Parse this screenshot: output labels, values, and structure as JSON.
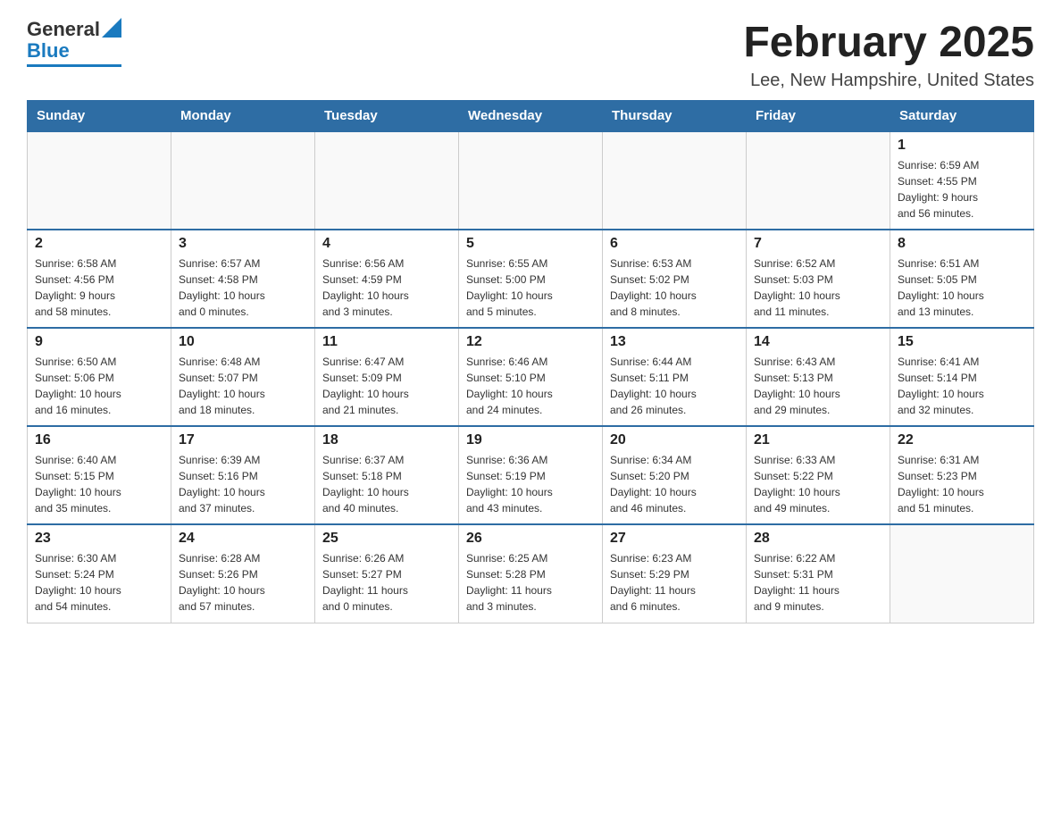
{
  "header": {
    "logo_general": "General",
    "logo_blue": "Blue",
    "title": "February 2025",
    "subtitle": "Lee, New Hampshire, United States"
  },
  "days_of_week": [
    "Sunday",
    "Monday",
    "Tuesday",
    "Wednesday",
    "Thursday",
    "Friday",
    "Saturday"
  ],
  "weeks": [
    [
      {
        "day": "",
        "info": ""
      },
      {
        "day": "",
        "info": ""
      },
      {
        "day": "",
        "info": ""
      },
      {
        "day": "",
        "info": ""
      },
      {
        "day": "",
        "info": ""
      },
      {
        "day": "",
        "info": ""
      },
      {
        "day": "1",
        "info": "Sunrise: 6:59 AM\nSunset: 4:55 PM\nDaylight: 9 hours\nand 56 minutes."
      }
    ],
    [
      {
        "day": "2",
        "info": "Sunrise: 6:58 AM\nSunset: 4:56 PM\nDaylight: 9 hours\nand 58 minutes."
      },
      {
        "day": "3",
        "info": "Sunrise: 6:57 AM\nSunset: 4:58 PM\nDaylight: 10 hours\nand 0 minutes."
      },
      {
        "day": "4",
        "info": "Sunrise: 6:56 AM\nSunset: 4:59 PM\nDaylight: 10 hours\nand 3 minutes."
      },
      {
        "day": "5",
        "info": "Sunrise: 6:55 AM\nSunset: 5:00 PM\nDaylight: 10 hours\nand 5 minutes."
      },
      {
        "day": "6",
        "info": "Sunrise: 6:53 AM\nSunset: 5:02 PM\nDaylight: 10 hours\nand 8 minutes."
      },
      {
        "day": "7",
        "info": "Sunrise: 6:52 AM\nSunset: 5:03 PM\nDaylight: 10 hours\nand 11 minutes."
      },
      {
        "day": "8",
        "info": "Sunrise: 6:51 AM\nSunset: 5:05 PM\nDaylight: 10 hours\nand 13 minutes."
      }
    ],
    [
      {
        "day": "9",
        "info": "Sunrise: 6:50 AM\nSunset: 5:06 PM\nDaylight: 10 hours\nand 16 minutes."
      },
      {
        "day": "10",
        "info": "Sunrise: 6:48 AM\nSunset: 5:07 PM\nDaylight: 10 hours\nand 18 minutes."
      },
      {
        "day": "11",
        "info": "Sunrise: 6:47 AM\nSunset: 5:09 PM\nDaylight: 10 hours\nand 21 minutes."
      },
      {
        "day": "12",
        "info": "Sunrise: 6:46 AM\nSunset: 5:10 PM\nDaylight: 10 hours\nand 24 minutes."
      },
      {
        "day": "13",
        "info": "Sunrise: 6:44 AM\nSunset: 5:11 PM\nDaylight: 10 hours\nand 26 minutes."
      },
      {
        "day": "14",
        "info": "Sunrise: 6:43 AM\nSunset: 5:13 PM\nDaylight: 10 hours\nand 29 minutes."
      },
      {
        "day": "15",
        "info": "Sunrise: 6:41 AM\nSunset: 5:14 PM\nDaylight: 10 hours\nand 32 minutes."
      }
    ],
    [
      {
        "day": "16",
        "info": "Sunrise: 6:40 AM\nSunset: 5:15 PM\nDaylight: 10 hours\nand 35 minutes."
      },
      {
        "day": "17",
        "info": "Sunrise: 6:39 AM\nSunset: 5:16 PM\nDaylight: 10 hours\nand 37 minutes."
      },
      {
        "day": "18",
        "info": "Sunrise: 6:37 AM\nSunset: 5:18 PM\nDaylight: 10 hours\nand 40 minutes."
      },
      {
        "day": "19",
        "info": "Sunrise: 6:36 AM\nSunset: 5:19 PM\nDaylight: 10 hours\nand 43 minutes."
      },
      {
        "day": "20",
        "info": "Sunrise: 6:34 AM\nSunset: 5:20 PM\nDaylight: 10 hours\nand 46 minutes."
      },
      {
        "day": "21",
        "info": "Sunrise: 6:33 AM\nSunset: 5:22 PM\nDaylight: 10 hours\nand 49 minutes."
      },
      {
        "day": "22",
        "info": "Sunrise: 6:31 AM\nSunset: 5:23 PM\nDaylight: 10 hours\nand 51 minutes."
      }
    ],
    [
      {
        "day": "23",
        "info": "Sunrise: 6:30 AM\nSunset: 5:24 PM\nDaylight: 10 hours\nand 54 minutes."
      },
      {
        "day": "24",
        "info": "Sunrise: 6:28 AM\nSunset: 5:26 PM\nDaylight: 10 hours\nand 57 minutes."
      },
      {
        "day": "25",
        "info": "Sunrise: 6:26 AM\nSunset: 5:27 PM\nDaylight: 11 hours\nand 0 minutes."
      },
      {
        "day": "26",
        "info": "Sunrise: 6:25 AM\nSunset: 5:28 PM\nDaylight: 11 hours\nand 3 minutes."
      },
      {
        "day": "27",
        "info": "Sunrise: 6:23 AM\nSunset: 5:29 PM\nDaylight: 11 hours\nand 6 minutes."
      },
      {
        "day": "28",
        "info": "Sunrise: 6:22 AM\nSunset: 5:31 PM\nDaylight: 11 hours\nand 9 minutes."
      },
      {
        "day": "",
        "info": ""
      }
    ]
  ]
}
